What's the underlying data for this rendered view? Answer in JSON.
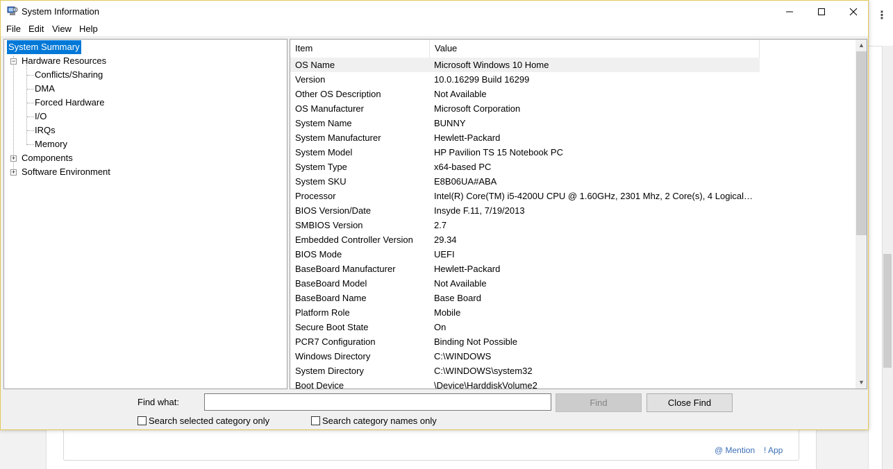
{
  "window": {
    "title": "System Information"
  },
  "menu": [
    "File",
    "Edit",
    "View",
    "Help"
  ],
  "tree": {
    "root": "System Summary",
    "hardware": "Hardware Resources",
    "hardware_children": [
      "Conflicts/Sharing",
      "DMA",
      "Forced Hardware",
      "I/O",
      "IRQs",
      "Memory"
    ],
    "components": "Components",
    "software": "Software Environment"
  },
  "list": {
    "columns": [
      "Item",
      "Value"
    ],
    "rows": [
      {
        "item": "OS Name",
        "value": "Microsoft Windows 10 Home"
      },
      {
        "item": "Version",
        "value": "10.0.16299 Build 16299"
      },
      {
        "item": "Other OS Description",
        "value": "Not Available"
      },
      {
        "item": "OS Manufacturer",
        "value": "Microsoft Corporation"
      },
      {
        "item": "System Name",
        "value": "BUNNY"
      },
      {
        "item": "System Manufacturer",
        "value": "Hewlett-Packard"
      },
      {
        "item": "System Model",
        "value": "HP Pavilion TS 15 Notebook PC"
      },
      {
        "item": "System Type",
        "value": "x64-based PC"
      },
      {
        "item": "System SKU",
        "value": "E8B06UA#ABA"
      },
      {
        "item": "Processor",
        "value": "Intel(R) Core(TM) i5-4200U CPU @ 1.60GHz, 2301 Mhz, 2 Core(s), 4 Logical Pr..."
      },
      {
        "item": "BIOS Version/Date",
        "value": "Insyde F.11, 7/19/2013"
      },
      {
        "item": "SMBIOS Version",
        "value": "2.7"
      },
      {
        "item": "Embedded Controller Version",
        "value": "29.34"
      },
      {
        "item": "BIOS Mode",
        "value": "UEFI"
      },
      {
        "item": "BaseBoard Manufacturer",
        "value": "Hewlett-Packard"
      },
      {
        "item": "BaseBoard Model",
        "value": "Not Available"
      },
      {
        "item": "BaseBoard Name",
        "value": "Base Board"
      },
      {
        "item": "Platform Role",
        "value": "Mobile"
      },
      {
        "item": "Secure Boot State",
        "value": "On"
      },
      {
        "item": "PCR7 Configuration",
        "value": "Binding Not Possible"
      },
      {
        "item": "Windows Directory",
        "value": "C:\\WINDOWS"
      },
      {
        "item": "System Directory",
        "value": "C:\\WINDOWS\\system32"
      },
      {
        "item": "Boot Device",
        "value": "\\Device\\HarddiskVolume2"
      }
    ]
  },
  "find": {
    "label": "Find what:",
    "value": "",
    "find_button": "Find",
    "close_button": "Close Find",
    "chk_selected_label": "Search selected category only",
    "chk_names_label": "Search category names only"
  },
  "background": {
    "mention_link": "@ Mention",
    "app_link": "! App"
  },
  "colors": {
    "selection": "#0078d7",
    "window_border": "#e2c75a"
  }
}
